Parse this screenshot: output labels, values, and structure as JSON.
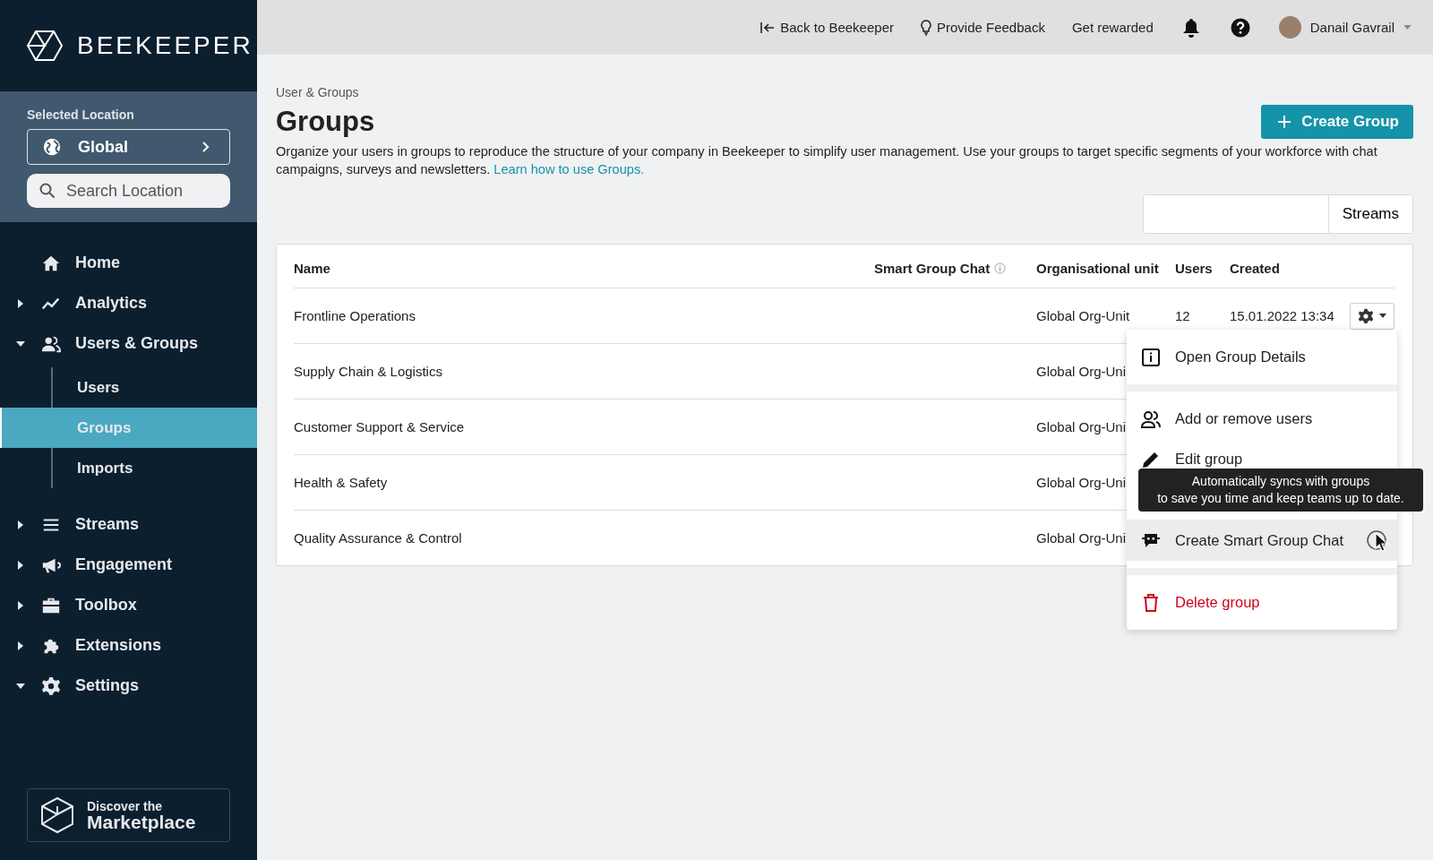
{
  "brand": {
    "name": "BEEKEEPER"
  },
  "location": {
    "label": "Selected Location",
    "value": "Global",
    "search_placeholder": "Search Location"
  },
  "nav": [
    {
      "label": "Home",
      "expandable": false,
      "selected": false
    },
    {
      "label": "Analytics",
      "expandable": true,
      "expanded": false,
      "selected": false
    },
    {
      "label": "Users & Groups",
      "expandable": true,
      "expanded": true,
      "selected": false,
      "children": [
        {
          "label": "Users",
          "selected": false
        },
        {
          "label": "Groups",
          "selected": true
        },
        {
          "label": "Imports",
          "selected": false
        }
      ]
    },
    {
      "label": "Streams",
      "expandable": true,
      "expanded": false,
      "selected": false
    },
    {
      "label": "Engagement",
      "expandable": true,
      "expanded": false,
      "selected": false
    },
    {
      "label": "Toolbox",
      "expandable": true,
      "expanded": false,
      "selected": false
    },
    {
      "label": "Extensions",
      "expandable": true,
      "expanded": false,
      "selected": false
    },
    {
      "label": "Settings",
      "expandable": true,
      "expanded": true,
      "selected": false
    }
  ],
  "marketplace": {
    "line_1": "Discover the",
    "line_2": "Marketplace"
  },
  "topbar": {
    "back": "Back to Beekeeper",
    "feedback": "Provide Feedback",
    "rewards": "Get rewarded",
    "user": "Danail Gavrail"
  },
  "breadcrumb": "User & Groups",
  "title": "Groups",
  "create_button": "Create Group",
  "description": "Organize your users in groups to reproduce the structure of your company in Beekeeper to simplify user management. Use your groups to target specific segments of your workforce with chat campaigns, surveys and newsletters.",
  "help_link": "Learn how to use Groups.",
  "filter": {
    "button": "Streams"
  },
  "table": {
    "columns": [
      "Name",
      "Smart Group Chat",
      "Organisational unit",
      "Users",
      "Created"
    ],
    "rows": [
      {
        "name": "Frontline Operations",
        "org_unit": "Global Org-Unit",
        "users": "12",
        "created": "15.01.2022 13:34",
        "actions": true
      },
      {
        "name": "Supply Chain & Logistics",
        "org_unit": "Global Org-Uni"
      },
      {
        "name": "Customer Support & Service",
        "org_unit": "Global Org-Uni"
      },
      {
        "name": "Health & Safety",
        "org_unit": "Global Org-Uni"
      },
      {
        "name": "Quality Assurance & Control",
        "org_unit": "Global Org-Uni"
      }
    ]
  },
  "menu": {
    "sections": [
      [
        {
          "label": "Open Group Details",
          "kind": "normal",
          "highlighted": false
        }
      ],
      [
        {
          "label": "Add or remove users",
          "kind": "normal",
          "highlighted": false
        },
        {
          "label": "Edit group",
          "kind": "normal",
          "highlighted": false
        },
        {
          "label": "Create Smart Group Chat",
          "kind": "normal",
          "highlighted": true,
          "tooltip": "Automatically syncs with groups\nto save you time and keep teams up to date."
        }
      ],
      [
        {
          "label": "Delete group",
          "kind": "danger",
          "highlighted": false
        }
      ]
    ]
  }
}
